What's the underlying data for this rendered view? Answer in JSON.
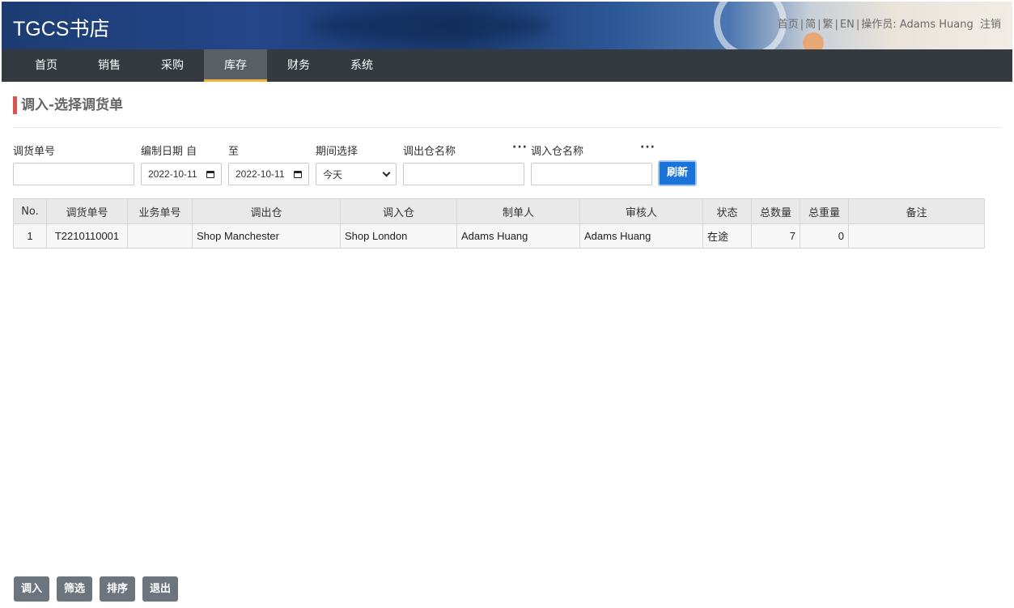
{
  "header": {
    "brand": "TGCS书店",
    "links": {
      "home": "首页",
      "simplified": "简",
      "traditional": "繁",
      "english": "EN",
      "operator_label": "操作员:",
      "operator_name": "Adams Huang",
      "logout": "注销"
    }
  },
  "nav": {
    "items": [
      {
        "label": "首页"
      },
      {
        "label": "销售"
      },
      {
        "label": "采购"
      },
      {
        "label": "库存",
        "active": true
      },
      {
        "label": "财务"
      },
      {
        "label": "系统"
      }
    ]
  },
  "page": {
    "title": "调入-选择调货单"
  },
  "filters": {
    "transfer_no_label": "调货单号",
    "transfer_no_value": "",
    "date_from_label": "编制日期 自",
    "date_from_value": "2022-10-11",
    "date_to_label": "至",
    "date_to_value": "2022-10-11",
    "period_label": "期间选择",
    "period_value": "今天",
    "out_wh_label": "调出仓名称",
    "out_wh_value": "",
    "in_wh_label": "调入仓名称",
    "in_wh_value": "",
    "more_glyph": "···",
    "refresh_label": "刷新"
  },
  "table": {
    "columns": [
      "No.",
      "调货单号",
      "业务单号",
      "调出仓",
      "调入仓",
      "制单人",
      "审核人",
      "状态",
      "总数量",
      "总重量",
      "备注"
    ],
    "rows": [
      {
        "no": "1",
        "transfer_no": "T2210110001",
        "business_no": "",
        "out_wh": "Shop Manchester",
        "in_wh": "Shop London",
        "maker": "Adams Huang",
        "reviewer": "Adams Huang",
        "status": "在途",
        "total_qty": "7",
        "total_weight": "0",
        "remark": ""
      }
    ]
  },
  "actions": {
    "transfer_in": "调入",
    "filter": "筛选",
    "sort": "排序",
    "exit": "退出"
  },
  "colors": {
    "nav_bg": "#343a40",
    "nav_active_underline": "#f0b43c",
    "title_accent": "#d9534f",
    "refresh_bg": "#1a73d9",
    "action_btn_bg": "#6c757d"
  }
}
